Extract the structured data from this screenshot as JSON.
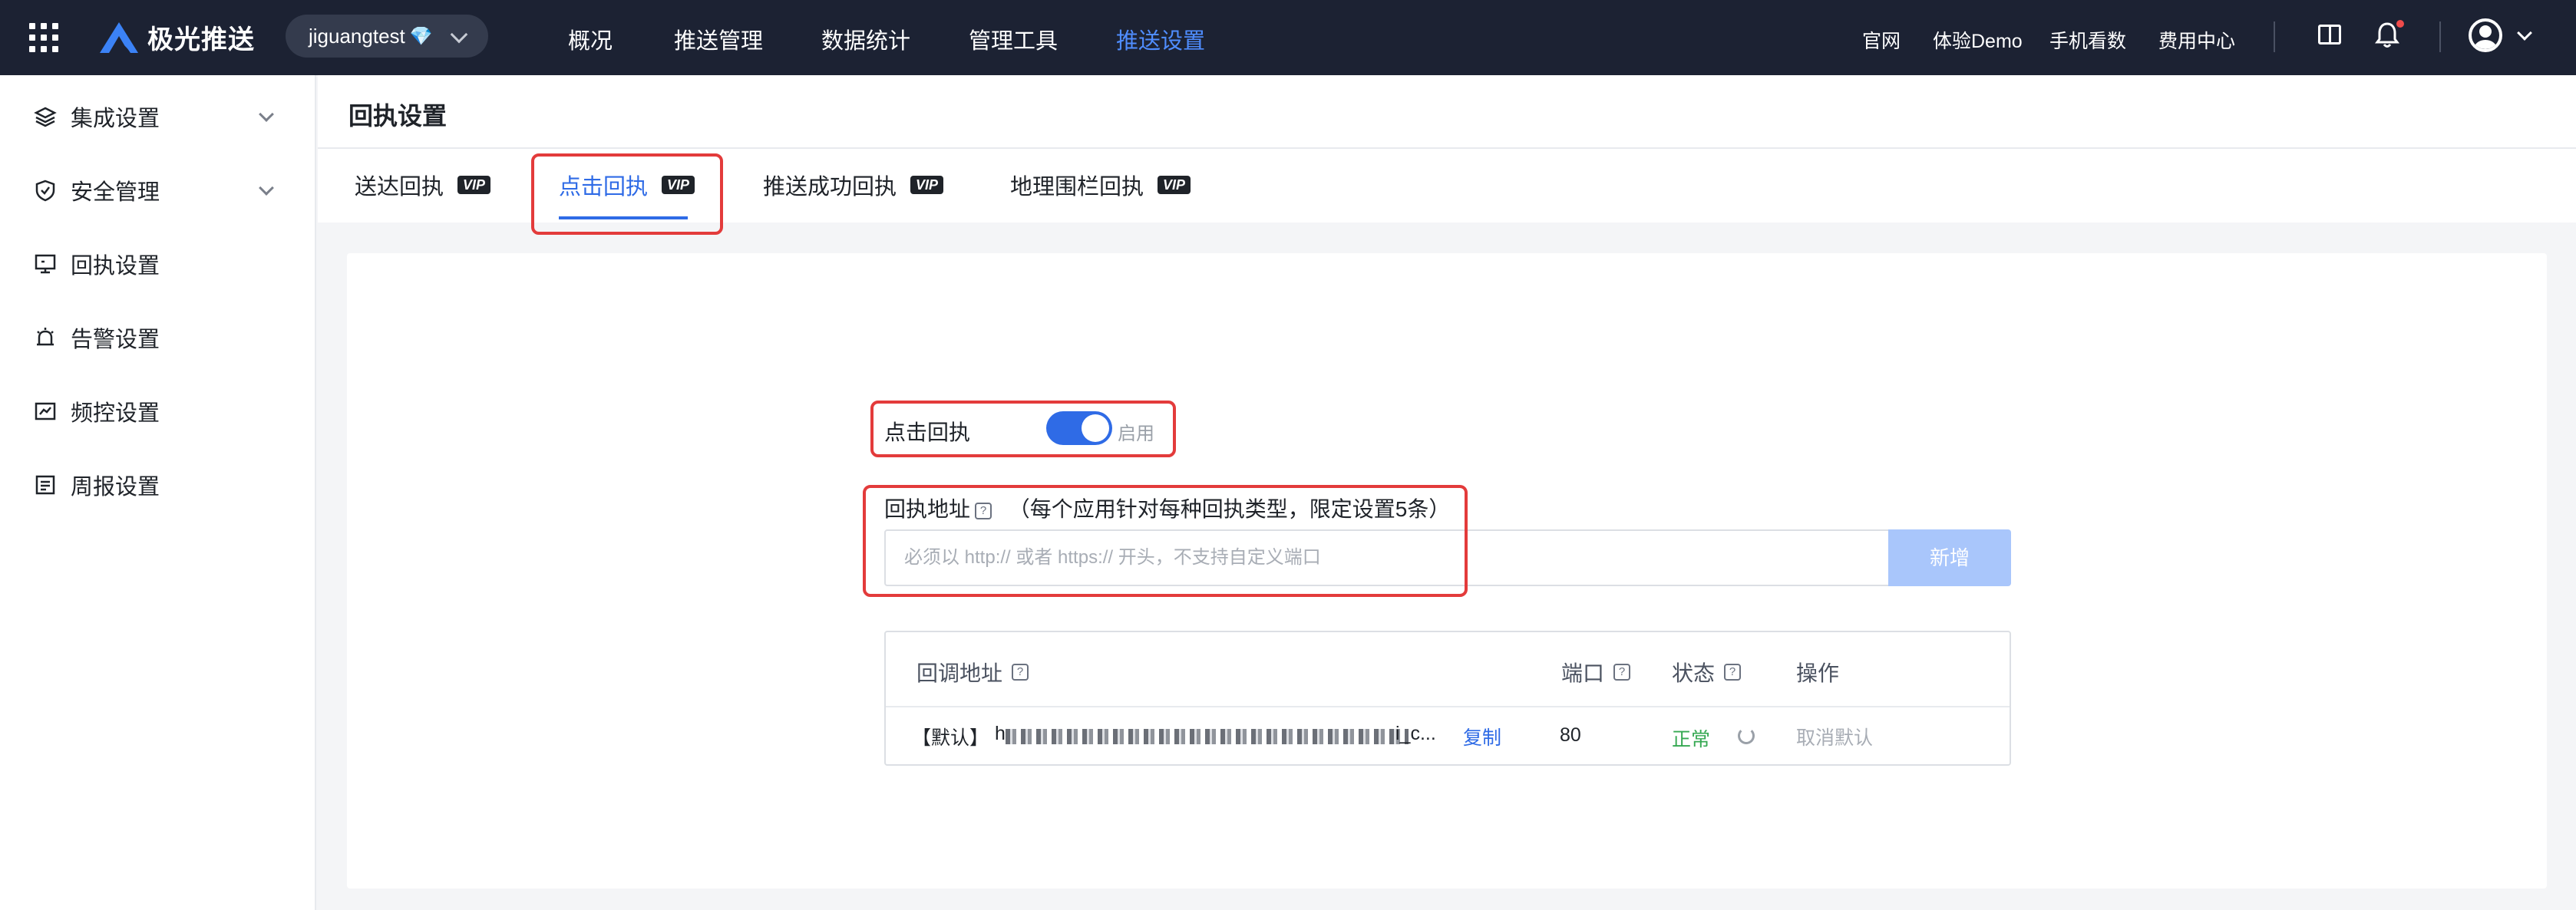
{
  "header": {
    "brand": "极光推送",
    "app_name": "jiguangtest",
    "app_badge": "💎",
    "nav": [
      "概况",
      "推送管理",
      "数据统计",
      "管理工具",
      "推送设置"
    ],
    "active_nav": "推送设置",
    "links": [
      "官网",
      "体验Demo",
      "手机看数",
      "费用中心"
    ]
  },
  "sidebar": {
    "items": [
      {
        "label": "集成设置",
        "icon": "layers-icon",
        "expandable": true
      },
      {
        "label": "安全管理",
        "icon": "shield-icon",
        "expandable": true
      },
      {
        "label": "回执设置",
        "icon": "monitor-icon",
        "expandable": false
      },
      {
        "label": "告警设置",
        "icon": "alarm-icon",
        "expandable": false
      },
      {
        "label": "频控设置",
        "icon": "chart-box-icon",
        "expandable": false
      },
      {
        "label": "周报设置",
        "icon": "report-icon",
        "expandable": false
      }
    ]
  },
  "page": {
    "title": "回执设置",
    "tabs": [
      {
        "label": "送达回执",
        "badge": "VIP"
      },
      {
        "label": "点击回执",
        "badge": "VIP",
        "active": true
      },
      {
        "label": "推送成功回执",
        "badge": "VIP"
      },
      {
        "label": "地理围栏回执",
        "badge": "VIP"
      }
    ]
  },
  "form": {
    "toggle_label": "点击回执",
    "toggle_on": true,
    "toggle_text": "启用",
    "address_label": "回执地址",
    "address_hint": "（每个应用针对每种回执类型，限定设置5条）",
    "input_placeholder": "必须以 http:// 或者 https:// 开头，不支持自定义端口",
    "add_button": "新增"
  },
  "table": {
    "headers": [
      "回调地址",
      "端口",
      "状态",
      "操作"
    ],
    "rows": [
      {
        "prefix": "【默认】",
        "url_start": "h",
        "url_end": "i_c...",
        "copy": "复制",
        "port": "80",
        "status": "正常",
        "action": "取消默认"
      }
    ]
  },
  "colors": {
    "topbar": "#1c2233",
    "accent": "#2f6be6",
    "highlight": "#e33b3b",
    "ok": "#36a852"
  }
}
